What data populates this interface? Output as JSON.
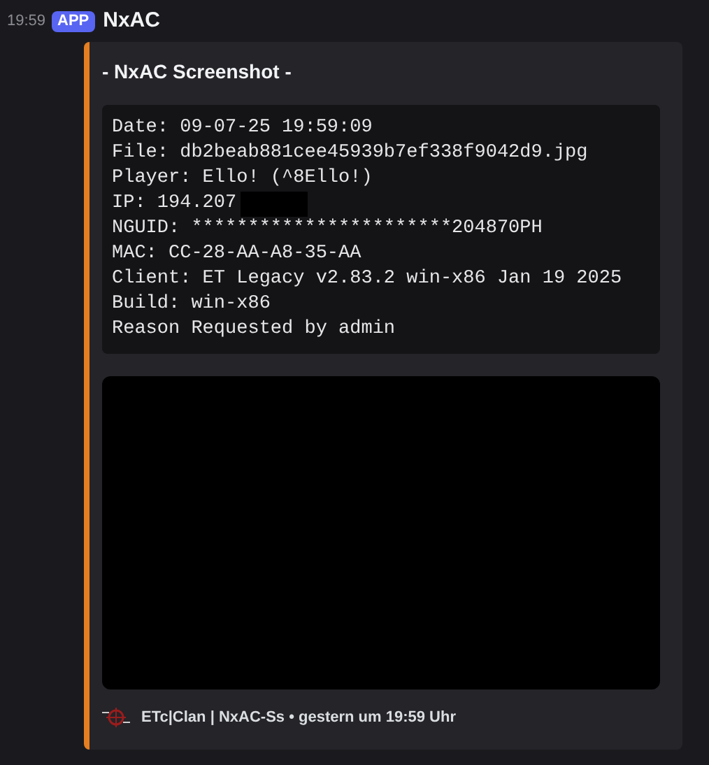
{
  "message": {
    "time": "19:59",
    "badge": "APP",
    "author": "NxAC"
  },
  "embed": {
    "title": "- NxAC Screenshot -",
    "lines": [
      {
        "text": "Date: 09-07-25 19:59:09",
        "redacted": false
      },
      {
        "text": "File: db2beab881cee45939b7ef338f9042d9.jpg",
        "redacted": false
      },
      {
        "text": "Player: Ello! (^8Ello!)",
        "redacted": false
      },
      {
        "text": "IP: 194.207",
        "redacted": true
      },
      {
        "text": "NGUID: ***********************204870PH",
        "redacted": false
      },
      {
        "text": "MAC: CC-28-AA-A8-35-AA",
        "redacted": false
      },
      {
        "text": "Client: ET Legacy v2.83.2 win-x86 Jan 19 2025",
        "redacted": false
      },
      {
        "text": "Build: win-x86",
        "redacted": false
      },
      {
        "text": "Reason Requested by admin",
        "redacted": false
      }
    ],
    "footer": "ETc|Clan | NxAC-Ss • gestern um 19:59 Uhr"
  }
}
